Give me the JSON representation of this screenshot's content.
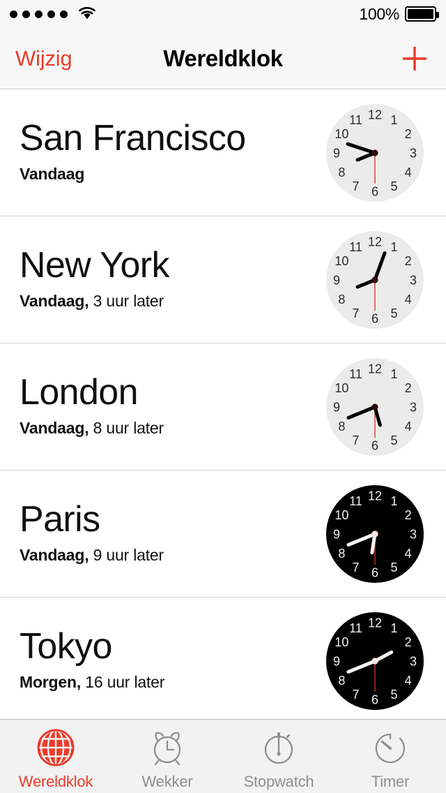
{
  "status_bar": {
    "signal_dots": 5,
    "wifi_icon": "wifi-icon",
    "battery_percent": "100%",
    "battery_level": 100
  },
  "nav_bar": {
    "edit_label": "Wijzig",
    "title": "Wereldklok",
    "add_icon": "plus-icon",
    "accent_color": "#ec3b2b"
  },
  "clocks": [
    {
      "city": "San Francisco",
      "day": "Vandaag",
      "offset": "",
      "face": "light",
      "hour_deg": 248,
      "minute_deg": 288,
      "second_deg": 180
    },
    {
      "city": "New York",
      "day": "Vandaag,",
      "offset": " 3 uur later",
      "face": "light",
      "hour_deg": 248,
      "minute_deg": 20,
      "second_deg": 180
    },
    {
      "city": "London",
      "day": "Vandaag,",
      "offset": " 8 uur later",
      "face": "light",
      "hour_deg": 164,
      "minute_deg": 248,
      "second_deg": 180
    },
    {
      "city": "Paris",
      "day": "Vandaag,",
      "offset": " 9 uur later",
      "face": "dark",
      "hour_deg": 189,
      "minute_deg": 248,
      "second_deg": 180
    },
    {
      "city": "Tokyo",
      "day": "Morgen,",
      "offset": " 16 uur later",
      "face": "dark",
      "hour_deg": 62,
      "minute_deg": 248,
      "second_deg": 180
    }
  ],
  "tab_bar": {
    "active_color": "#ec3b2b",
    "inactive_color": "#8e8e8e",
    "tabs": [
      {
        "label": "Wereldklok",
        "icon": "globe-icon",
        "active": true
      },
      {
        "label": "Wekker",
        "icon": "alarm-clock-icon",
        "active": false
      },
      {
        "label": "Stopwatch",
        "icon": "stopwatch-icon",
        "active": false
      },
      {
        "label": "Timer",
        "icon": "timer-icon",
        "active": false
      }
    ]
  }
}
